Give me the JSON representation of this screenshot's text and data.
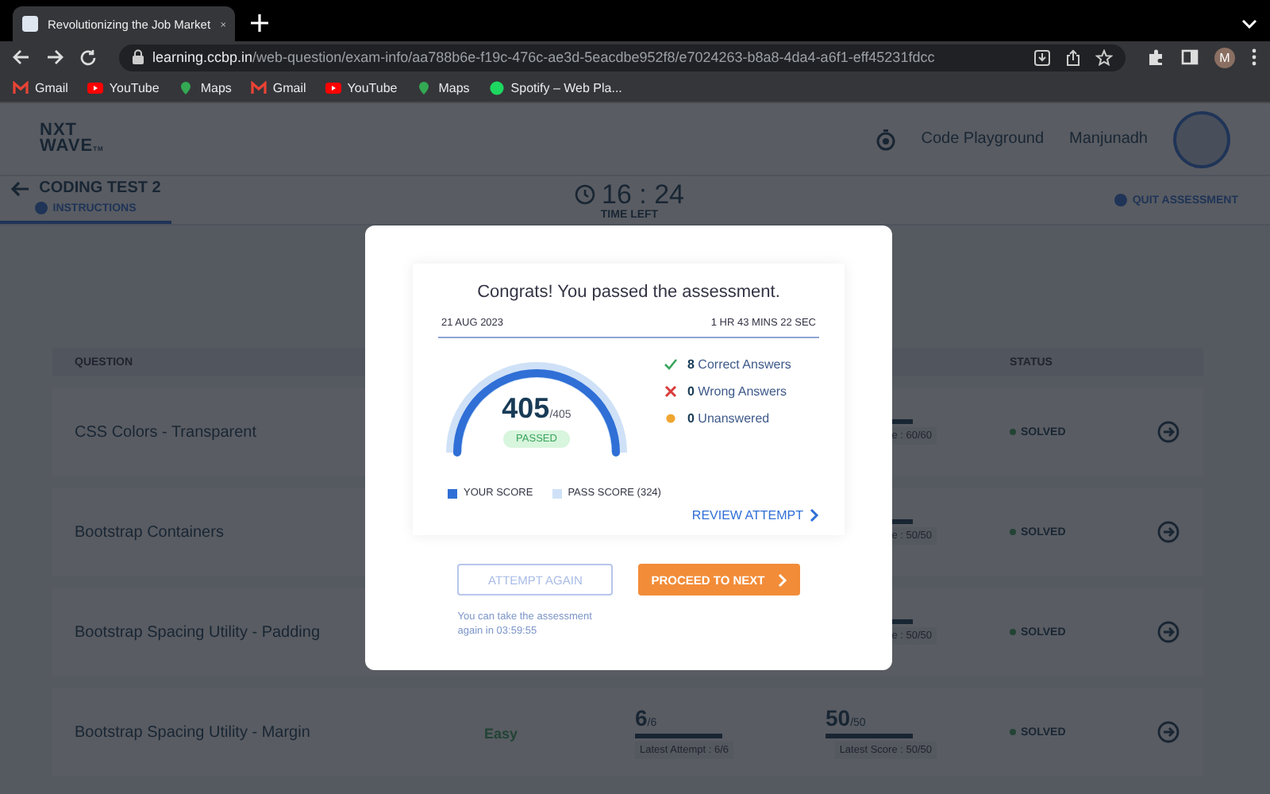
{
  "browser": {
    "tab": {
      "title": "Revolutionizing the Job Market"
    },
    "url_host": "learning.ccbp.in",
    "url_path": "/web-question/exam-info/aa788b6e-f19c-476c-ae3d-5eacdbe952f8/e7024263-b8a8-4da4-a6f1-eff45231fdcc",
    "profile_initial": "M",
    "bookmarks": [
      {
        "kind": "gmail",
        "label": "Gmail"
      },
      {
        "kind": "youtube",
        "label": "YouTube"
      },
      {
        "kind": "maps",
        "label": "Maps"
      },
      {
        "kind": "gmail",
        "label": "Gmail"
      },
      {
        "kind": "youtube",
        "label": "YouTube"
      },
      {
        "kind": "maps",
        "label": "Maps"
      },
      {
        "kind": "spotify",
        "label": "Spotify – Web Pla..."
      }
    ]
  },
  "header": {
    "logo_line1": "NXT",
    "logo_line2": "WAVE",
    "logo_mark": "TM",
    "code_playground": "Code Playground",
    "user_name": "Manjunadh"
  },
  "test_bar": {
    "title": "CODING TEST 2",
    "tab": "INSTRUCTIONS",
    "timer": "16 : 24",
    "timer_label": "TIME LEFT",
    "quit": "QUIT ASSESSMENT"
  },
  "table": {
    "question_header": "QUESTION",
    "status_header": "STATUS",
    "rows": [
      {
        "question": "CSS Colors - Transparent",
        "score_bar": {
          "level": 1
        },
        "score_caption": "e : 60/60",
        "status": "SOLVED"
      },
      {
        "question": "Bootstrap Containers",
        "score_bar": {
          "level": 1
        },
        "score_caption": "e : 50/50",
        "status": "SOLVED"
      },
      {
        "question": "Bootstrap Spacing Utility - Padding",
        "score_bar": {
          "level": 1
        },
        "score_caption": "e : 50/50",
        "status": "SOLVED"
      },
      {
        "question": "Bootstrap Spacing Utility - Margin",
        "difficulty": "Easy",
        "attempts": "6",
        "attempts_total": "/6",
        "attempts_bar": {
          "level": 1
        },
        "attempts_caption": "Latest Attempt : 6/6",
        "score": "50",
        "score_total": "/50",
        "score_bar": {
          "level": 1
        },
        "score_caption": "Latest Score : 50/50",
        "status": "SOLVED"
      }
    ]
  },
  "modal": {
    "title": "Congrats! You passed the assessment.",
    "date": "21 AUG 2023",
    "duration": "1 HR 43 MINS 22 SEC",
    "score": "405",
    "score_total": "/405",
    "badge": "PASSED",
    "score_arc": {
      "level": 1
    },
    "stats": [
      {
        "kind": "correct",
        "count": "8",
        "label": "Correct Answers"
      },
      {
        "kind": "wrong",
        "count": "0",
        "label": "Wrong Answers"
      },
      {
        "kind": "unanswered",
        "count": "0",
        "label": "Unanswered"
      }
    ],
    "legend": [
      {
        "kind": "score",
        "label": "YOUR SCORE"
      },
      {
        "kind": "pass",
        "label": "PASS SCORE (324)"
      }
    ],
    "review": "REVIEW ATTEMPT",
    "attempt_again": {
      "label": "ATTEMPT AGAIN",
      "disabled": true
    },
    "retake_note": "You can take the assessment again in 03:59:55",
    "proceed": "PROCEED TO NEXT"
  }
}
